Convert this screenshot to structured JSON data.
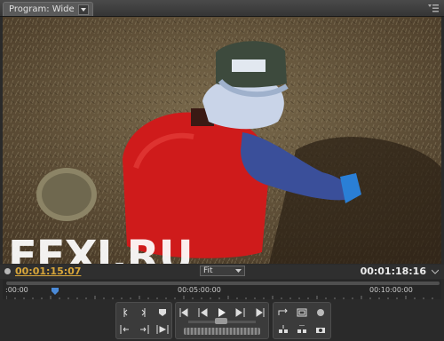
{
  "panel": {
    "tab_label": "Program: Wide",
    "tab_dropdown_icon": "triangle-down-icon",
    "menu_icon": "panel-menu-icon"
  },
  "viewer": {
    "watermark": "EFXI.RU"
  },
  "timecode": {
    "current": "00:01:15:07",
    "duration": "00:01:18:16",
    "zoom": "Fit"
  },
  "ruler": {
    "labels": [
      ":00:00",
      "00:05:00:00",
      "00:10:00:00"
    ]
  },
  "colors": {
    "current_timecode": "#d9a73a",
    "background": "#2a2a2a"
  }
}
